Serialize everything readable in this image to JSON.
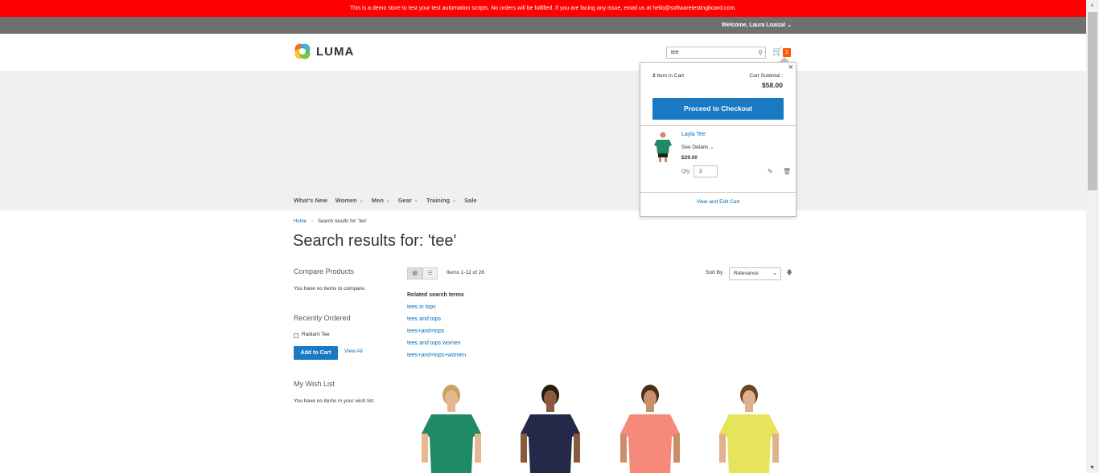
{
  "demo_notice": "This is a demo store to test your test automation scripts. No orders will be fulfilled. If you are facing any issue, email us at hello@softwaretestingboard.com.",
  "header": {
    "welcome": "Welcome, Laura Loaizal",
    "logo_text": "LUMA",
    "search_value": "tee",
    "cart_count": "2"
  },
  "nav": [
    "What's New",
    "Women",
    "Men",
    "Gear",
    "Training",
    "Sale"
  ],
  "breadcrumb": {
    "home": "Home",
    "current": "Search results for: 'tee'"
  },
  "page_title": "Search results for: 'tee'",
  "sidebar": {
    "compare_title": "Compare Products",
    "compare_text": "You have no items to compare.",
    "recent_title": "Recently Ordered",
    "recent_item": "Radiant Tee",
    "add_to_cart": "Add to Cart",
    "view_all": "View All",
    "wish_title": "My Wish List",
    "wish_text": "You have no items in your wish list."
  },
  "toolbar": {
    "amount": "Items 1-12 of 26",
    "sort_label": "Sort By",
    "sort_value": "Relevance"
  },
  "related": {
    "title": "Related search terms",
    "terms": [
      "tees in tops",
      "tees and tops",
      "tees+and+tops",
      "tees and tops women",
      "tees+and+tops+women"
    ]
  },
  "minicart": {
    "count": "2",
    "count_label": "Item in Cart",
    "subtotal_label": "Cart Subtotal :",
    "subtotal": "$58.00",
    "checkout": "Proceed to Checkout",
    "product_name": "Layla Tee",
    "see_details": "See Details",
    "price": "$29.00",
    "qty_label": "Qty:",
    "qty": "2",
    "view_edit": "View and Edit Cart"
  },
  "colors": {
    "demo_bar": "#ff0000",
    "panel": "#6e716e",
    "primary_button": "#1979c3",
    "link": "#006bb4",
    "cart_badge": "#ff5501"
  },
  "products": [
    {
      "shirt": "#1f8a63",
      "skin": "#e7b78f",
      "hair": "#c9a25e"
    },
    {
      "shirt": "#232947",
      "skin": "#8a5a3c",
      "hair": "#2b1a10"
    },
    {
      "shirt": "#f58a7a",
      "skin": "#c98f6b",
      "hair": "#4a2c1a"
    },
    {
      "shirt": "#e5e45b",
      "skin": "#e2b08d",
      "hair": "#6b4424"
    }
  ]
}
